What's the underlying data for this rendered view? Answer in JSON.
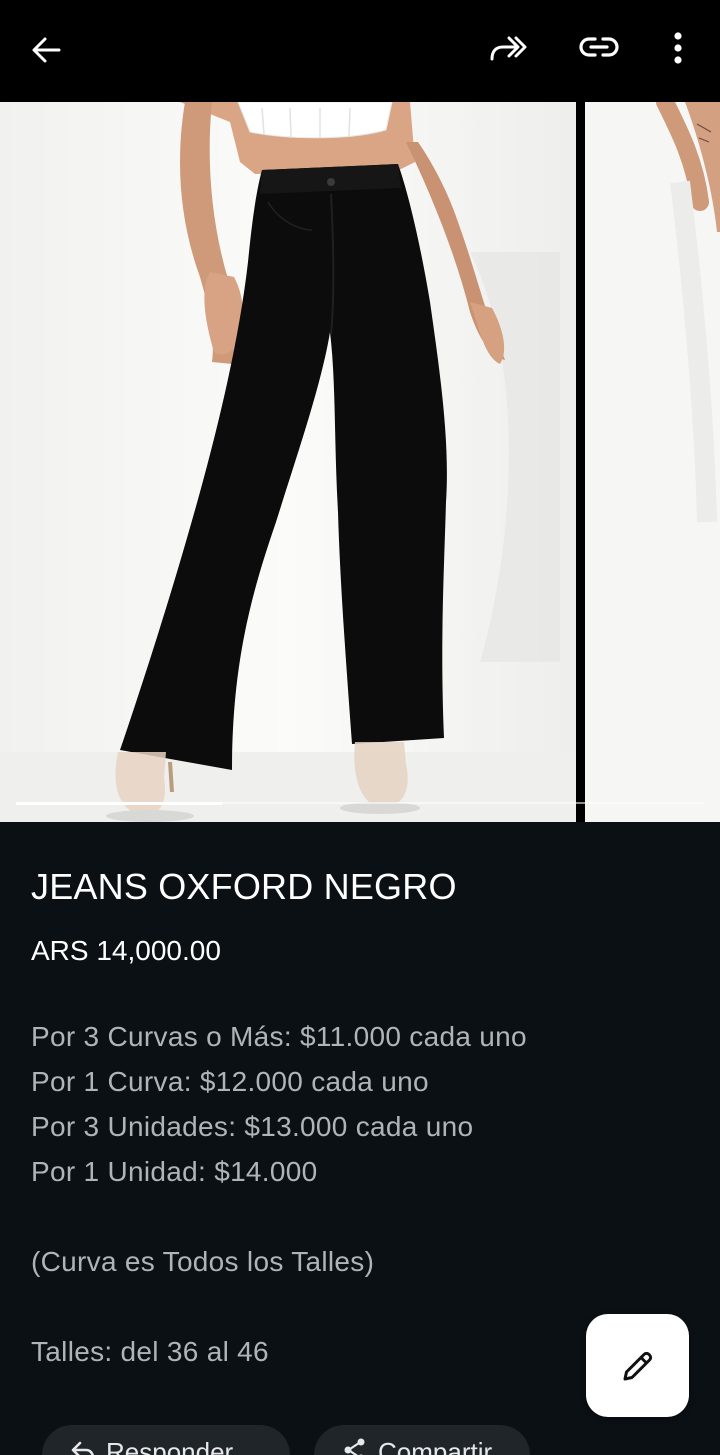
{
  "toolbar": {
    "back_icon": "arrow-left-icon",
    "forward_icon": "double-forward-arrow-icon",
    "link_icon": "link-icon",
    "more_icon": "more-vertical-icon"
  },
  "carousel": {
    "images": [
      "jeans-front-image",
      "jeans-side-image"
    ],
    "current_index": 0,
    "progress_fraction": 0.3
  },
  "product": {
    "title": "JEANS OXFORD NEGRO",
    "price": "ARS 14,000.00",
    "description": [
      "Por 3 Curvas o Más: $11.000 cada uno",
      "Por 1 Curva: $12.000 cada uno",
      "Por 3 Unidades: $13.000 cada uno",
      "Por 1 Unidad: $14.000",
      "(Curva es Todos los Talles)",
      "Talles: del 36 al 46"
    ]
  },
  "fab": {
    "icon": "pencil-icon"
  },
  "actions": [
    {
      "label": "Responder",
      "icon": "reply-icon"
    },
    {
      "label": "Compartir",
      "icon": "share-icon"
    }
  ],
  "colors": {
    "toolbar_bg": "#000000",
    "page_bg": "#0b1014",
    "title_text": "#ffffff",
    "description_text": "#aeb4b9",
    "fab_bg": "#ffffff",
    "chip_bg": "#1f2529"
  }
}
